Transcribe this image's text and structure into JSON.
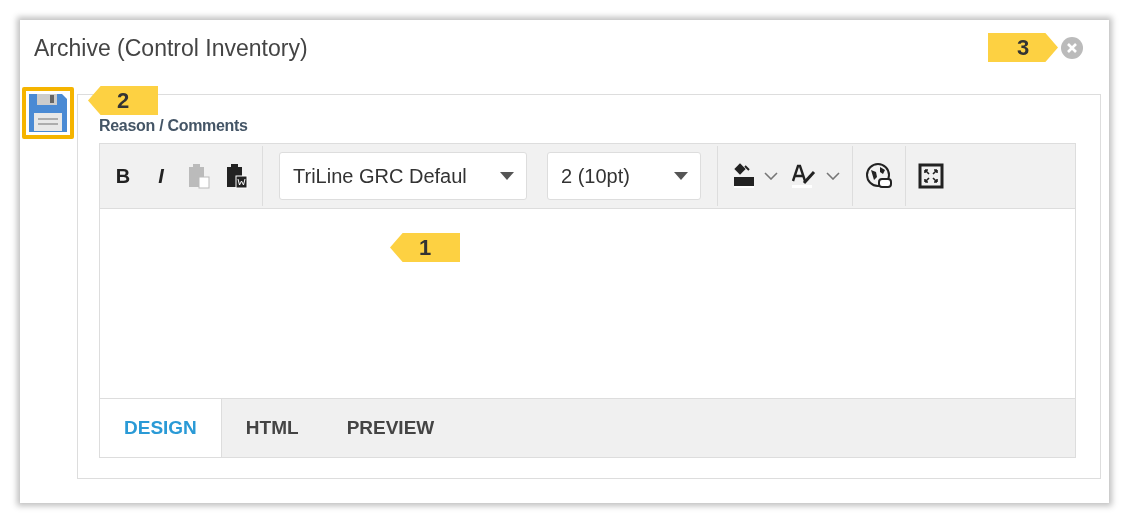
{
  "window": {
    "title": "Archive (Control Inventory)"
  },
  "field": {
    "label": "Reason / Comments"
  },
  "toolbar": [
    {
      "kind": "text",
      "label": "B",
      "disabled": false
    },
    {
      "kind": "text",
      "label": "I",
      "disabled": false
    },
    {
      "kind": "paste",
      "disabled": true
    },
    {
      "kind": "paste-word",
      "disabled": false
    },
    {
      "kind": "sep"
    },
    {
      "kind": "font-select",
      "value": "TriLine GRC Defaul"
    },
    {
      "kind": "size-select",
      "value": "2 (10pt)"
    },
    {
      "kind": "sep"
    },
    {
      "kind": "highlight",
      "disabled": false
    },
    {
      "kind": "fontcolor",
      "disabled": false
    },
    {
      "kind": "sep"
    },
    {
      "kind": "link",
      "disabled": false
    },
    {
      "kind": "sep"
    },
    {
      "kind": "fullscreen",
      "disabled": false
    }
  ],
  "tabs": [
    {
      "label": "DESIGN",
      "selected": true
    },
    {
      "label": "HTML",
      "selected": false
    },
    {
      "label": "PREVIEW",
      "selected": false
    }
  ],
  "callouts": [
    {
      "label": "1",
      "kind": "left-pointer"
    },
    {
      "label": "2",
      "kind": "left-pointer"
    },
    {
      "label": "3",
      "kind": "right-pointer"
    }
  ]
}
